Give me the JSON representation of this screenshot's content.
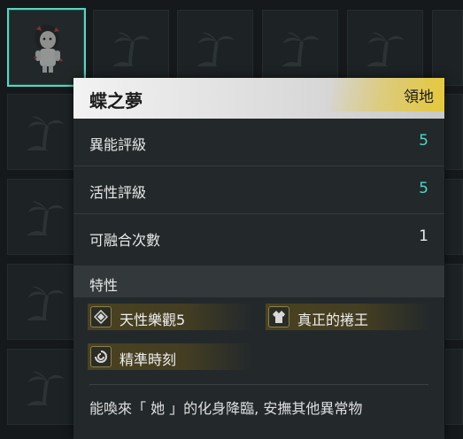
{
  "card": {
    "title": "蝶之夢",
    "tag": "領地",
    "rows": [
      {
        "label": "異能評級",
        "value": "5"
      },
      {
        "label": "活性評級",
        "value": "5"
      },
      {
        "label": "可融合次數",
        "value": "1"
      }
    ],
    "traits_heading": "特性",
    "traits": [
      {
        "label": "天性樂觀5",
        "icon": "diamond-icon"
      },
      {
        "label": "真正的捲王",
        "icon": "jacket-icon"
      },
      {
        "label": "精準時刻",
        "icon": "swirl-icon"
      }
    ],
    "description": "能喚來「 她 」的化身降臨, 安撫其他異常物"
  },
  "colors": {
    "accent_teal": "#4fd6c4",
    "tag_gold": "#e5c93a",
    "selection": "#5fd3c0"
  }
}
